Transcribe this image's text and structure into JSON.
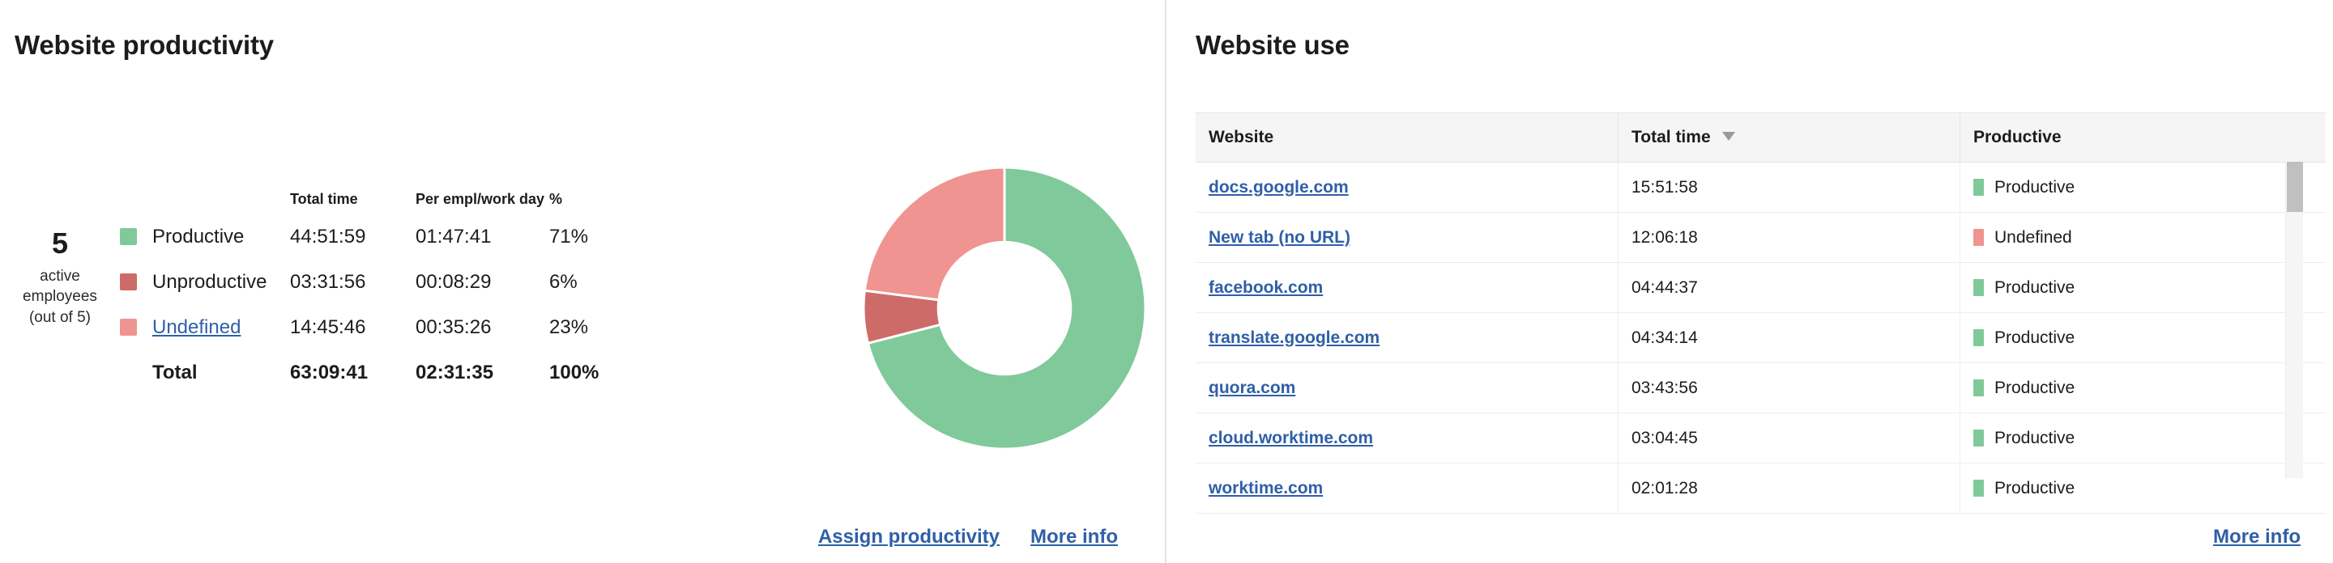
{
  "left_panel": {
    "title": "Website productivity",
    "employees": {
      "count": "5",
      "line1": "active",
      "line2": "employees",
      "line3": "(out of 5)"
    },
    "columns": {
      "swatch": "",
      "label": "",
      "total_time": "Total time",
      "per_empl": "Per empl/work day",
      "percent": "%"
    },
    "rows": [
      {
        "label": "Productive",
        "total_time": "44:51:59",
        "per_empl": "01:47:41",
        "percent": "71%",
        "color": "#80c99a",
        "is_link": false
      },
      {
        "label": "Unproductive",
        "total_time": "03:31:56",
        "per_empl": "00:08:29",
        "percent": "6%",
        "color": "#cd6b68",
        "is_link": false
      },
      {
        "label": "Undefined",
        "total_time": "14:45:46",
        "per_empl": "00:35:26",
        "percent": "23%",
        "color": "#ef9490",
        "is_link": true
      }
    ],
    "total_row": {
      "label": "Total",
      "total_time": "63:09:41",
      "per_empl": "02:31:35",
      "percent": "100%"
    },
    "footer": {
      "assign_productivity": "Assign productivity",
      "more_info": "More info"
    }
  },
  "right_panel": {
    "title": "Website use",
    "columns": {
      "website": "Website",
      "total_time": "Total time",
      "productive": "Productive"
    },
    "sort": {
      "column": "Total time",
      "direction": "descending",
      "icon": "caret-down-icon"
    },
    "rows": [
      {
        "website": "docs.google.com",
        "total_time": "15:51:58",
        "productivity": "Productive",
        "color": "#80c99a"
      },
      {
        "website": "New tab (no URL)",
        "total_time": "12:06:18",
        "productivity": "Undefined",
        "color": "#ef9490"
      },
      {
        "website": "facebook.com",
        "total_time": "04:44:37",
        "productivity": "Productive",
        "color": "#80c99a"
      },
      {
        "website": "translate.google.com",
        "total_time": "04:34:14",
        "productivity": "Productive",
        "color": "#80c99a"
      },
      {
        "website": "quora.com",
        "total_time": "03:43:56",
        "productivity": "Productive",
        "color": "#80c99a"
      },
      {
        "website": "cloud.worktime.com",
        "total_time": "03:04:45",
        "productivity": "Productive",
        "color": "#80c99a"
      },
      {
        "website": "worktime.com",
        "total_time": "02:01:28",
        "productivity": "Productive",
        "color": "#80c99a"
      }
    ],
    "footer": {
      "more_info": "More info"
    }
  },
  "chart_data": {
    "type": "pie",
    "title": "Website productivity",
    "variant": "donut",
    "start_angle_deg": 0,
    "direction": "clockwise",
    "inner_radius_ratio": 0.47,
    "categories": [
      "Productive",
      "Unproductive",
      "Undefined"
    ],
    "values": [
      71,
      6,
      23
    ],
    "value_unit": "%",
    "raw_times": [
      "44:51:59",
      "03:31:56",
      "14:45:46"
    ],
    "colors": [
      "#80c99a",
      "#cd6b68",
      "#ef9490"
    ],
    "legend": "left-table",
    "grid": false,
    "total_label": "Total",
    "total_value": "100%"
  },
  "theme": {
    "link_color": "#2f5fa7",
    "text_color": "#1c1c1c",
    "header_bg": "#f5f5f5",
    "border": "#e4e4e4",
    "scrollbar_thumb": "#c0c0c0",
    "scrollbar_track": "#f5f5f5"
  }
}
